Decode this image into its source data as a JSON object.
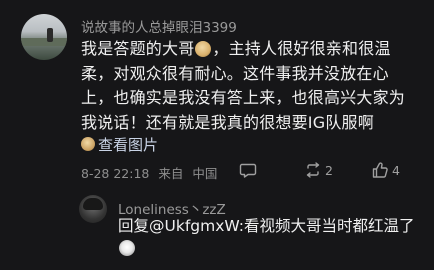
{
  "comment": {
    "username": "说故事的人总掉眼泪3399",
    "text_before_emoji": "我是答题的大哥",
    "emoji_name": "face-emoji",
    "text_after_emoji": "，主持人很好很亲和很温柔，对观众很有耐心。这件事我并没放在心上，也确实是我没有答上来，也很高兴大家为我说话！还有就是我真的很想要IG队服啊",
    "view_image_label": "查看图片",
    "date": "8-28 22:18",
    "source": "来自",
    "location": "中国",
    "reply_count": "",
    "repost_count": "2",
    "like_count": "4"
  },
  "reply": {
    "username": "Loneliness丶zzZ",
    "text": "回复@UkfgmxW:看视频大哥当时都红温了",
    "emoji_name": "shocked-face-emoji"
  },
  "icons": [
    "comment-icon",
    "repost-icon",
    "like-icon",
    "image-icon"
  ]
}
